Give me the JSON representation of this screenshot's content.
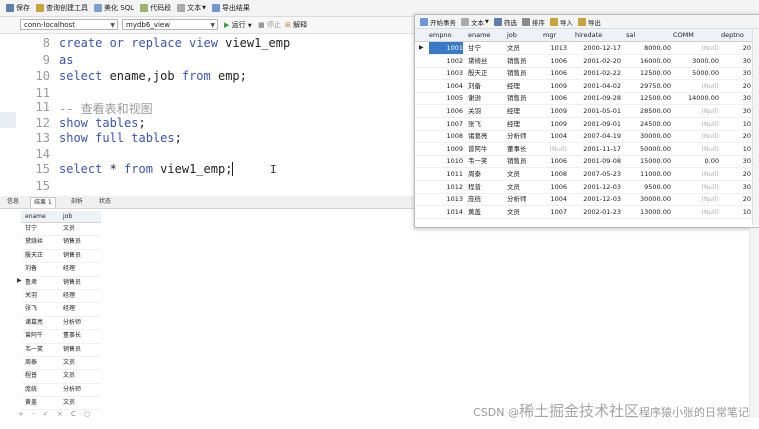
{
  "toolbar": {
    "items": [
      "保存",
      "查询创建工具",
      "美化 SQL",
      "代码段",
      "文本",
      "导出结果"
    ]
  },
  "conn_bar": {
    "connection": "conn-localhost",
    "database": "mydb6_view",
    "run": "运行",
    "stop": "停止",
    "explain": "解释"
  },
  "editor": {
    "lines": [
      {
        "num": "8",
        "kw": "create or replace view",
        "rest": " view1_emp"
      },
      {
        "num": "9",
        "kw": "as",
        "rest": ""
      },
      {
        "num": "10",
        "kw": "select",
        "rest": " ename,job ",
        "kw2": "from",
        "rest2": " emp;"
      },
      {
        "num": "11",
        "kw": "",
        "rest": ""
      },
      {
        "num": "11",
        "comment": "-- 查看表和视图"
      },
      {
        "num": "12",
        "kw": "show tables",
        "rest": ";"
      },
      {
        "num": "13",
        "kw": "show full tables",
        "rest": ";"
      },
      {
        "num": "14",
        "kw": "",
        "rest": ""
      },
      {
        "num": "15",
        "kw": "select",
        "rest": " * ",
        "kw2": "from",
        "rest2": " view1_emp;"
      },
      {
        "num": "15",
        "kw": "",
        "rest": ""
      }
    ]
  },
  "result_tabs": [
    "信息",
    "结果 1",
    "剖析",
    "状态"
  ],
  "small_grid": {
    "headers": [
      "ename",
      "job"
    ],
    "rows": [
      [
        "甘宁",
        "文员"
      ],
      [
        "黛绮丝",
        "销售员"
      ],
      [
        "殷天正",
        "销售员"
      ],
      [
        "刘备",
        "经理"
      ],
      [
        "鲁肃",
        "销售员"
      ],
      [
        "关羽",
        "经理"
      ],
      [
        "张飞",
        "经理"
      ],
      [
        "诸葛亮",
        "分析师"
      ],
      [
        "曾阿牛",
        "董事长"
      ],
      [
        "韦一笑",
        "销售员"
      ],
      [
        "周泰",
        "文员"
      ],
      [
        "程普",
        "文员"
      ],
      [
        "庞统",
        "分析师"
      ],
      [
        "黄盖",
        "文员"
      ]
    ]
  },
  "bottom_nav": "+ - ✓ × C ○",
  "float_window": {
    "toolbar": [
      "开始事务",
      "文本",
      "筛选",
      "排序",
      "导入",
      "导出"
    ],
    "headers": [
      "empno",
      "ename",
      "job",
      "mgr",
      "hiredate",
      "sal",
      "COMM",
      "deptno"
    ],
    "null_text": "(Null)",
    "rows": [
      [
        "1001",
        "甘宁",
        "文员",
        "1013",
        "2000-12-17",
        "8000.00",
        null,
        "20"
      ],
      [
        "1002",
        "黛绮丝",
        "销售员",
        "1006",
        "2001-02-20",
        "16000.00",
        "3000.00",
        "30"
      ],
      [
        "1003",
        "殷天正",
        "销售员",
        "1006",
        "2001-02-22",
        "12500.00",
        "5000.00",
        "30"
      ],
      [
        "1004",
        "刘备",
        "经理",
        "1009",
        "2001-04-02",
        "29750.00",
        null,
        "20"
      ],
      [
        "1005",
        "谢逊",
        "销售员",
        "1006",
        "2001-09-28",
        "12500.00",
        "14000.00",
        "30"
      ],
      [
        "1006",
        "关羽",
        "经理",
        "1009",
        "2001-05-01",
        "28500.00",
        null,
        "30"
      ],
      [
        "1007",
        "张飞",
        "经理",
        "1009",
        "2001-09-01",
        "24500.00",
        null,
        "10"
      ],
      [
        "1008",
        "诸葛亮",
        "分析师",
        "1004",
        "2007-04-19",
        "30000.00",
        null,
        "20"
      ],
      [
        "1009",
        "曾阿牛",
        "董事长",
        null,
        "2001-11-17",
        "50000.00",
        null,
        "10"
      ],
      [
        "1010",
        "韦一笑",
        "销售员",
        "1006",
        "2001-09-08",
        "15000.00",
        "0.00",
        "30"
      ],
      [
        "1011",
        "周泰",
        "文员",
        "1008",
        "2007-05-23",
        "11000.00",
        null,
        "20"
      ],
      [
        "1012",
        "程普",
        "文员",
        "1006",
        "2001-12-03",
        "9500.00",
        null,
        "30"
      ],
      [
        "1013",
        "庞统",
        "分析师",
        "1004",
        "2001-12-03",
        "30000.00",
        null,
        "20"
      ],
      [
        "1014",
        "黄盖",
        "文员",
        "1007",
        "2002-01-23",
        "13000.00",
        null,
        "10"
      ]
    ]
  },
  "watermark": {
    "prefix": "CSDN @",
    "big": "稀土掘金技术社区",
    "suffix": "程序猿小张的日常笔记"
  },
  "colors": {
    "keyword": "#3d54b5",
    "selection": "#3a78c8"
  }
}
